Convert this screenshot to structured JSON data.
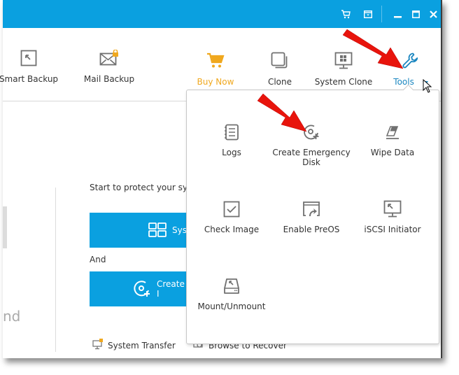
{
  "titlebar": {
    "icons": [
      "cart-icon",
      "menu-icon",
      "minimize-icon",
      "maximize-icon",
      "close-icon"
    ]
  },
  "toolbar": {
    "items": [
      {
        "label": "Smart Backup",
        "icon": "smart-backup-icon"
      },
      {
        "label": "Mail Backup",
        "icon": "mail-lock-icon"
      },
      {
        "label": "Buy Now",
        "icon": "cart-icon"
      },
      {
        "label": "Clone",
        "icon": "clone-icon"
      },
      {
        "label": "System Clone",
        "icon": "system-clone-icon"
      },
      {
        "label": "Tools",
        "icon": "wrench-icon"
      }
    ]
  },
  "main": {
    "start_text": "Start to protect your sys",
    "system_backup_label": "Syst",
    "and_text": "And",
    "create_label": "Create I",
    "partial_left_text": "nd",
    "system_transfer_label": "System Transfer",
    "browse_label": "Browse to Recover"
  },
  "tools_menu": {
    "items": [
      {
        "label": "Logs",
        "icon": "logs-icon"
      },
      {
        "label": "Create Emergency Disk",
        "icon": "emergency-disk-icon"
      },
      {
        "label": "Wipe Data",
        "icon": "eraser-icon"
      },
      {
        "label": "Check Image",
        "icon": "check-icon"
      },
      {
        "label": "Enable PreOS",
        "icon": "preos-icon"
      },
      {
        "label": "iSCSI Initiator",
        "icon": "iscsi-icon"
      },
      {
        "label": "Mount/Unmount",
        "icon": "drive-icon"
      }
    ]
  },
  "colors": {
    "accent": "#0aa0e0",
    "buy_now": "#f0a81e",
    "tools_active": "#1a86c0",
    "annotation_arrow": "#e8140c"
  }
}
